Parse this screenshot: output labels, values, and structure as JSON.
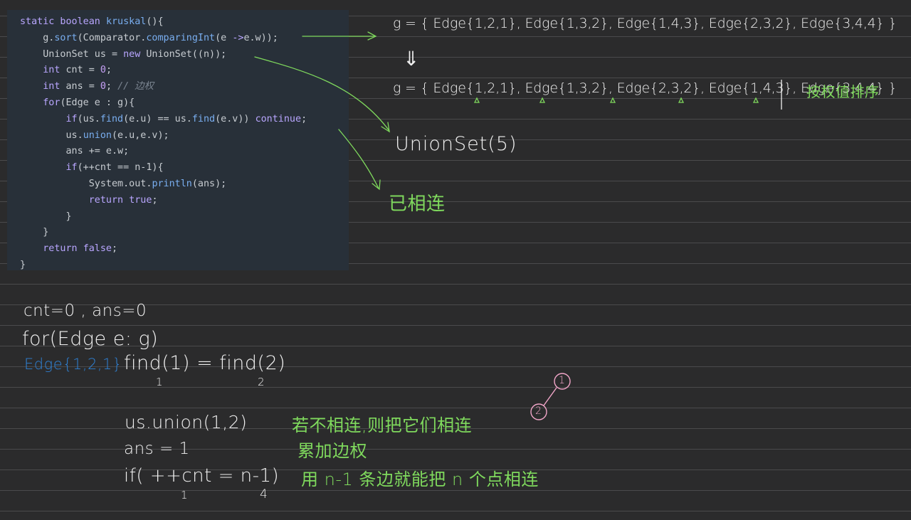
{
  "code": {
    "lines": [
      [
        {
          "t": "static boolean ",
          "c": "kw"
        },
        {
          "t": "kruskal",
          "c": "fn"
        },
        {
          "t": "(){",
          "c": ""
        }
      ],
      [
        {
          "t": "    g.",
          "c": ""
        },
        {
          "t": "sort",
          "c": "fn"
        },
        {
          "t": "(Comparator.",
          "c": ""
        },
        {
          "t": "comparingInt",
          "c": "fn"
        },
        {
          "t": "(e ",
          "c": ""
        },
        {
          "t": "->",
          "c": "kw"
        },
        {
          "t": "e.w));",
          "c": ""
        }
      ],
      [
        {
          "t": "    UnionSet us = ",
          "c": ""
        },
        {
          "t": "new",
          "c": "kw"
        },
        {
          "t": " UnionSet((n));",
          "c": ""
        }
      ],
      [
        {
          "t": "    ",
          "c": ""
        },
        {
          "t": "int",
          "c": "kw"
        },
        {
          "t": " cnt = ",
          "c": ""
        },
        {
          "t": "0",
          "c": "num"
        },
        {
          "t": ";",
          "c": ""
        }
      ],
      [
        {
          "t": "    ",
          "c": ""
        },
        {
          "t": "int",
          "c": "kw"
        },
        {
          "t": " ans = ",
          "c": ""
        },
        {
          "t": "0",
          "c": "num"
        },
        {
          "t": "; ",
          "c": ""
        },
        {
          "t": "// 边权",
          "c": "cm"
        }
      ],
      [
        {
          "t": "    ",
          "c": ""
        },
        {
          "t": "for",
          "c": "kw"
        },
        {
          "t": "(Edge e : g){",
          "c": ""
        }
      ],
      [
        {
          "t": "        ",
          "c": ""
        },
        {
          "t": "if",
          "c": "kw"
        },
        {
          "t": "(us.",
          "c": ""
        },
        {
          "t": "find",
          "c": "fn"
        },
        {
          "t": "(e.u) == us.",
          "c": ""
        },
        {
          "t": "find",
          "c": "fn"
        },
        {
          "t": "(e.v)) ",
          "c": ""
        },
        {
          "t": "continue",
          "c": "kw"
        },
        {
          "t": ";",
          "c": ""
        }
      ],
      [
        {
          "t": "        us.",
          "c": ""
        },
        {
          "t": "union",
          "c": "fn"
        },
        {
          "t": "(e.u,e.v);",
          "c": ""
        }
      ],
      [
        {
          "t": "        ans += e.w;",
          "c": ""
        }
      ],
      [
        {
          "t": "        ",
          "c": ""
        },
        {
          "t": "if",
          "c": "kw"
        },
        {
          "t": "(++cnt == n-1){",
          "c": ""
        }
      ],
      [
        {
          "t": "            System.out.",
          "c": ""
        },
        {
          "t": "println",
          "c": "fn"
        },
        {
          "t": "(ans);",
          "c": ""
        }
      ],
      [
        {
          "t": "            ",
          "c": ""
        },
        {
          "t": "return",
          "c": "kw"
        },
        {
          "t": " ",
          "c": ""
        },
        {
          "t": "true",
          "c": "kw"
        },
        {
          "t": ";",
          "c": ""
        }
      ],
      [
        {
          "t": "        }",
          "c": ""
        }
      ],
      [
        {
          "t": "    }",
          "c": ""
        }
      ],
      [
        {
          "t": "    ",
          "c": ""
        },
        {
          "t": "return",
          "c": "kw"
        },
        {
          "t": " ",
          "c": ""
        },
        {
          "t": "false",
          "c": "kw"
        },
        {
          "t": ";",
          "c": ""
        }
      ],
      [
        {
          "t": "}",
          "c": ""
        }
      ]
    ]
  },
  "notes": {
    "g_unsorted": "g = { Edge{1,2,1}, Edge{1,3,2}, Edge{1,4,3}, Edge{2,3,2}, Edge{3,4,4} }",
    "double_arrow": "⇓",
    "g_sorted": "g = { Edge{1,2,1}, Edge{1,3,2}, Edge{2,3,2}, Edge{1,4,3}, Edge{3,4,4} }",
    "sort_label": "按权值排序",
    "unionset": "UnionSet(5)",
    "already_connected": "已相连",
    "init": "cnt=0 , ans=0",
    "for_loop": "for(Edge e: g)",
    "edge_current": "Edge{1,2,1}",
    "find_expr": "find(1) = find(2)",
    "find_val_left": "1",
    "find_val_right": "2",
    "union_call": "us.union(1,2)",
    "union_note": "若不相连,则把它们相连",
    "ans_expr": "ans = 1",
    "ans_note": "累加边权",
    "if_expr": "if( ++cnt = n-1)",
    "if_val_left": "1",
    "if_val_right": "4",
    "if_note": "用 n-1 条边就能把 n 个点相连",
    "node_1": "1",
    "node_2": "2"
  },
  "colors": {
    "background": "#2b2b2c",
    "code_bg": "#283039",
    "ink_white": "#f0f0f0",
    "ink_green": "#7fd95d",
    "ink_blue": "#2f82d6",
    "ink_pink": "#f2a6c9"
  }
}
